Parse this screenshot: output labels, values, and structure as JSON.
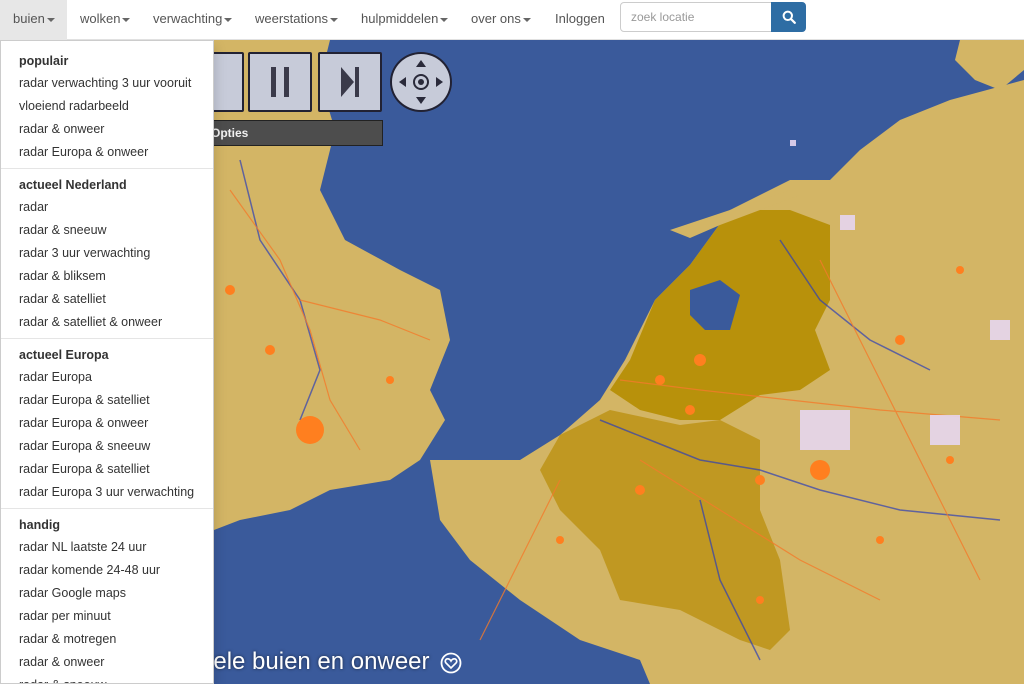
{
  "nav": {
    "items": [
      {
        "label": "buien",
        "caret": true,
        "active": true
      },
      {
        "label": "wolken",
        "caret": true
      },
      {
        "label": "verwachting",
        "caret": true
      },
      {
        "label": "weerstations",
        "caret": true
      },
      {
        "label": "hulpmiddelen",
        "caret": true
      },
      {
        "label": "over ons",
        "caret": true
      },
      {
        "label": "Inloggen",
        "caret": false
      }
    ],
    "search_placeholder": "zoek locatie",
    "search_icon": "search-icon"
  },
  "menu": {
    "sections": [
      {
        "header": "populair",
        "items": [
          "radar verwachting 3 uur vooruit",
          "vloeiend radarbeeld",
          "radar & onweer",
          "radar Europa & onweer"
        ]
      },
      {
        "header": "actueel Nederland",
        "items": [
          "radar",
          "radar & sneeuw",
          "radar 3 uur verwachting",
          "radar & bliksem",
          "radar & satelliet",
          "radar & satelliet & onweer"
        ]
      },
      {
        "header": "actueel Europa",
        "items": [
          "radar Europa",
          "radar Europa & satelliet",
          "radar Europa & onweer",
          "radar Europa & sneeuw",
          "radar Europa & satelliet",
          "radar Europa 3 uur verwachting"
        ]
      },
      {
        "header": "handig",
        "items": [
          "radar NL laatste 24 uur",
          "radar komende 24-48 uur",
          "radar Google maps",
          "radar per minuut",
          "radar & motregen",
          "radar & onweer",
          "radar & sneeuw"
        ]
      }
    ]
  },
  "player": {
    "opties_label": "Opties",
    "pause_icon": "pause-icon",
    "step_forward_icon": "step-forward-icon",
    "pan_icon": "pan-control-icon"
  },
  "map": {
    "caption": "uele buien en onweer",
    "caption_icon": "heart-icon"
  },
  "colors": {
    "sea": "#3a5a9b",
    "land": "#d3b565",
    "land_highlight": "#b8910b",
    "cities": "#ff7f1f",
    "search_button": "#2e6da4"
  }
}
